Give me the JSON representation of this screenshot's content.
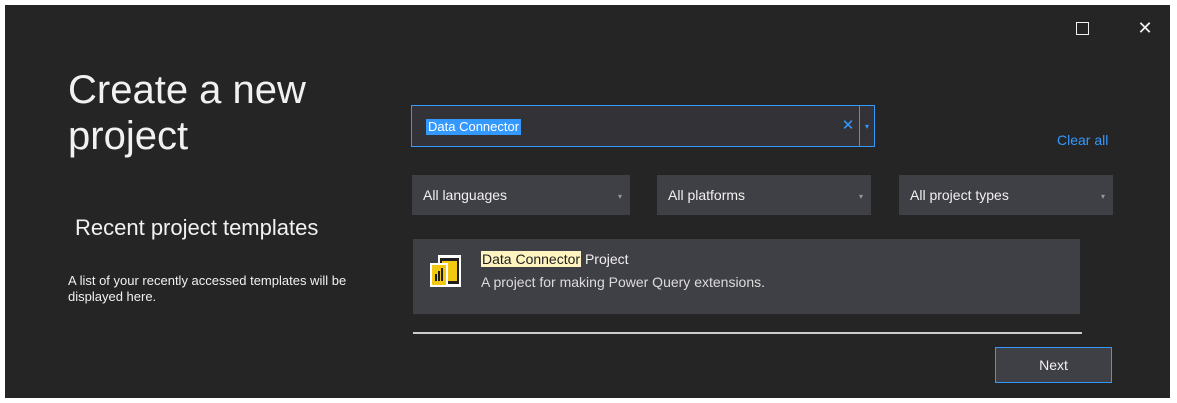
{
  "window": {
    "maximize_icon": "maximize-icon",
    "close_icon": "close-icon",
    "close_glyph": "✕"
  },
  "left_panel": {
    "title": "Create a new project",
    "recent_heading": "Recent project templates",
    "recent_description": "A list of your recently accessed templates will be displayed here."
  },
  "search": {
    "value": "Data Connector",
    "clear_glyph": "✕",
    "dropdown_glyph": "▾",
    "clear_all": "Clear all"
  },
  "filters": [
    {
      "label": "All languages"
    },
    {
      "label": "All platforms"
    },
    {
      "label": "All project types"
    }
  ],
  "results": [
    {
      "title_highlight": "Data Connector",
      "title_rest": " Project",
      "description": "A project for making Power Query extensions.",
      "icon": "power-query-file-icon"
    }
  ],
  "footer": {
    "next_label": "Next"
  },
  "colors": {
    "background": "#252526",
    "accent": "#3399ff",
    "panel": "#3f3f46",
    "highlight": "#fff4c0"
  }
}
